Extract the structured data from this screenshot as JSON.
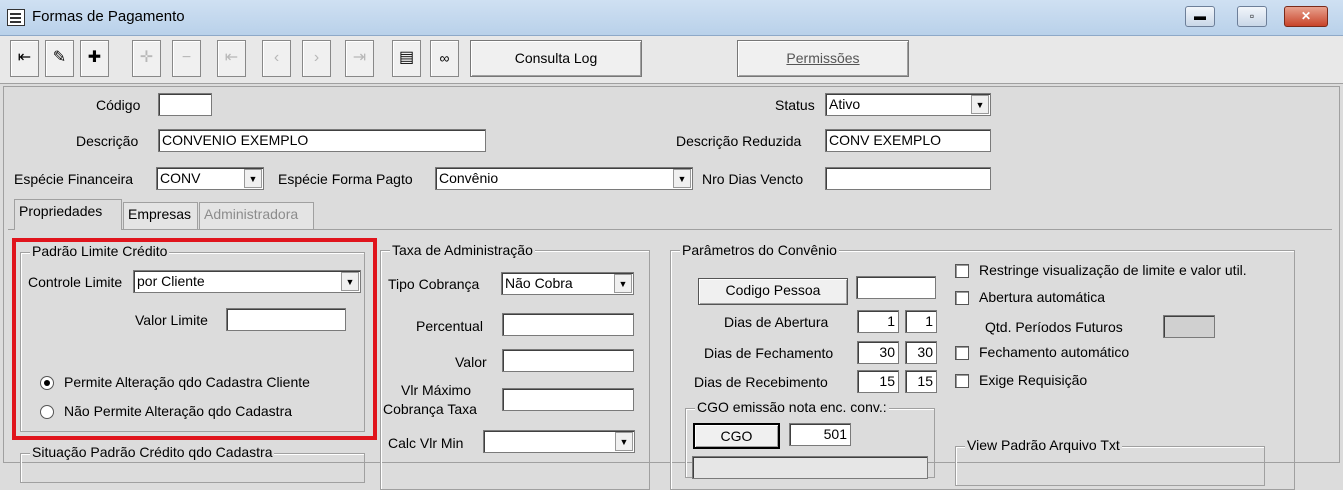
{
  "window": {
    "title": "Formas de Pagamento",
    "minimize": "▬",
    "maximize": "▫",
    "close": "✕"
  },
  "toolbar": {
    "consulta_log": "Consulta Log",
    "permissoes": "Permissões"
  },
  "header": {
    "codigo_label": "Código",
    "codigo_value": "",
    "status_label": "Status",
    "status_value": "Ativo",
    "descricao_label": "Descrição",
    "descricao_value": "CONVENIO EXEMPLO",
    "descricao_reduzida_label": "Descrição Reduzida",
    "descricao_reduzida_value": "CONV EXEMPLO",
    "especie_financeira_label": "Espécie Financeira",
    "especie_financeira_value": "CONV",
    "especie_forma_label": "Espécie Forma Pagto",
    "especie_forma_value": "Convênio",
    "nro_dias_label": "Nro Dias Vencto",
    "nro_dias_value": ""
  },
  "tabs": [
    "Propriedades",
    "Empresas",
    "Administradora"
  ],
  "padrao_limite": {
    "title": "Padrão Limite Crédito",
    "controle_label": "Controle Limite",
    "controle_value": "por Cliente",
    "valor_label": "Valor Limite",
    "valor_value": "",
    "radio1": "Permite Alteração qdo Cadastra Cliente",
    "radio2": "Não Permite Alteração qdo Cadastra"
  },
  "situacao": {
    "title": "Situação Padrão Crédito qdo Cadastra"
  },
  "taxa": {
    "title": "Taxa de Administração",
    "tipo_label": "Tipo Cobrança",
    "tipo_value": "Não Cobra",
    "percentual_label": "Percentual",
    "valor_label": "Valor",
    "vlr_max_label1": "Vlr Máximo",
    "vlr_max_label2": "Cobrança Taxa",
    "calc_label": "Calc Vlr Min"
  },
  "parametros": {
    "title": "Parâmetros do Convênio",
    "codigo_pessoa": "Codigo Pessoa",
    "abertura_label": "Dias de Abertura",
    "abertura_1": "1",
    "abertura_2": "1",
    "fechamento_label": "Dias de Fechamento",
    "fechamento_1": "30",
    "fechamento_2": "30",
    "recebimento_label": "Dias de Recebimento",
    "recebimento_1": "15",
    "recebimento_2": "15",
    "restringe": "Restringe visualização de limite e valor util.",
    "abertura_auto": "Abertura automática",
    "qtd_periodos": "Qtd. Períodos Futuros",
    "fechamento_auto": "Fechamento automático",
    "exige_req": "Exige Requisição",
    "cgo_title": "CGO emissão nota enc. conv.:",
    "cgo_button": "CGO",
    "cgo_value": "501",
    "view_title": "View Padrão Arquivo Txt"
  }
}
